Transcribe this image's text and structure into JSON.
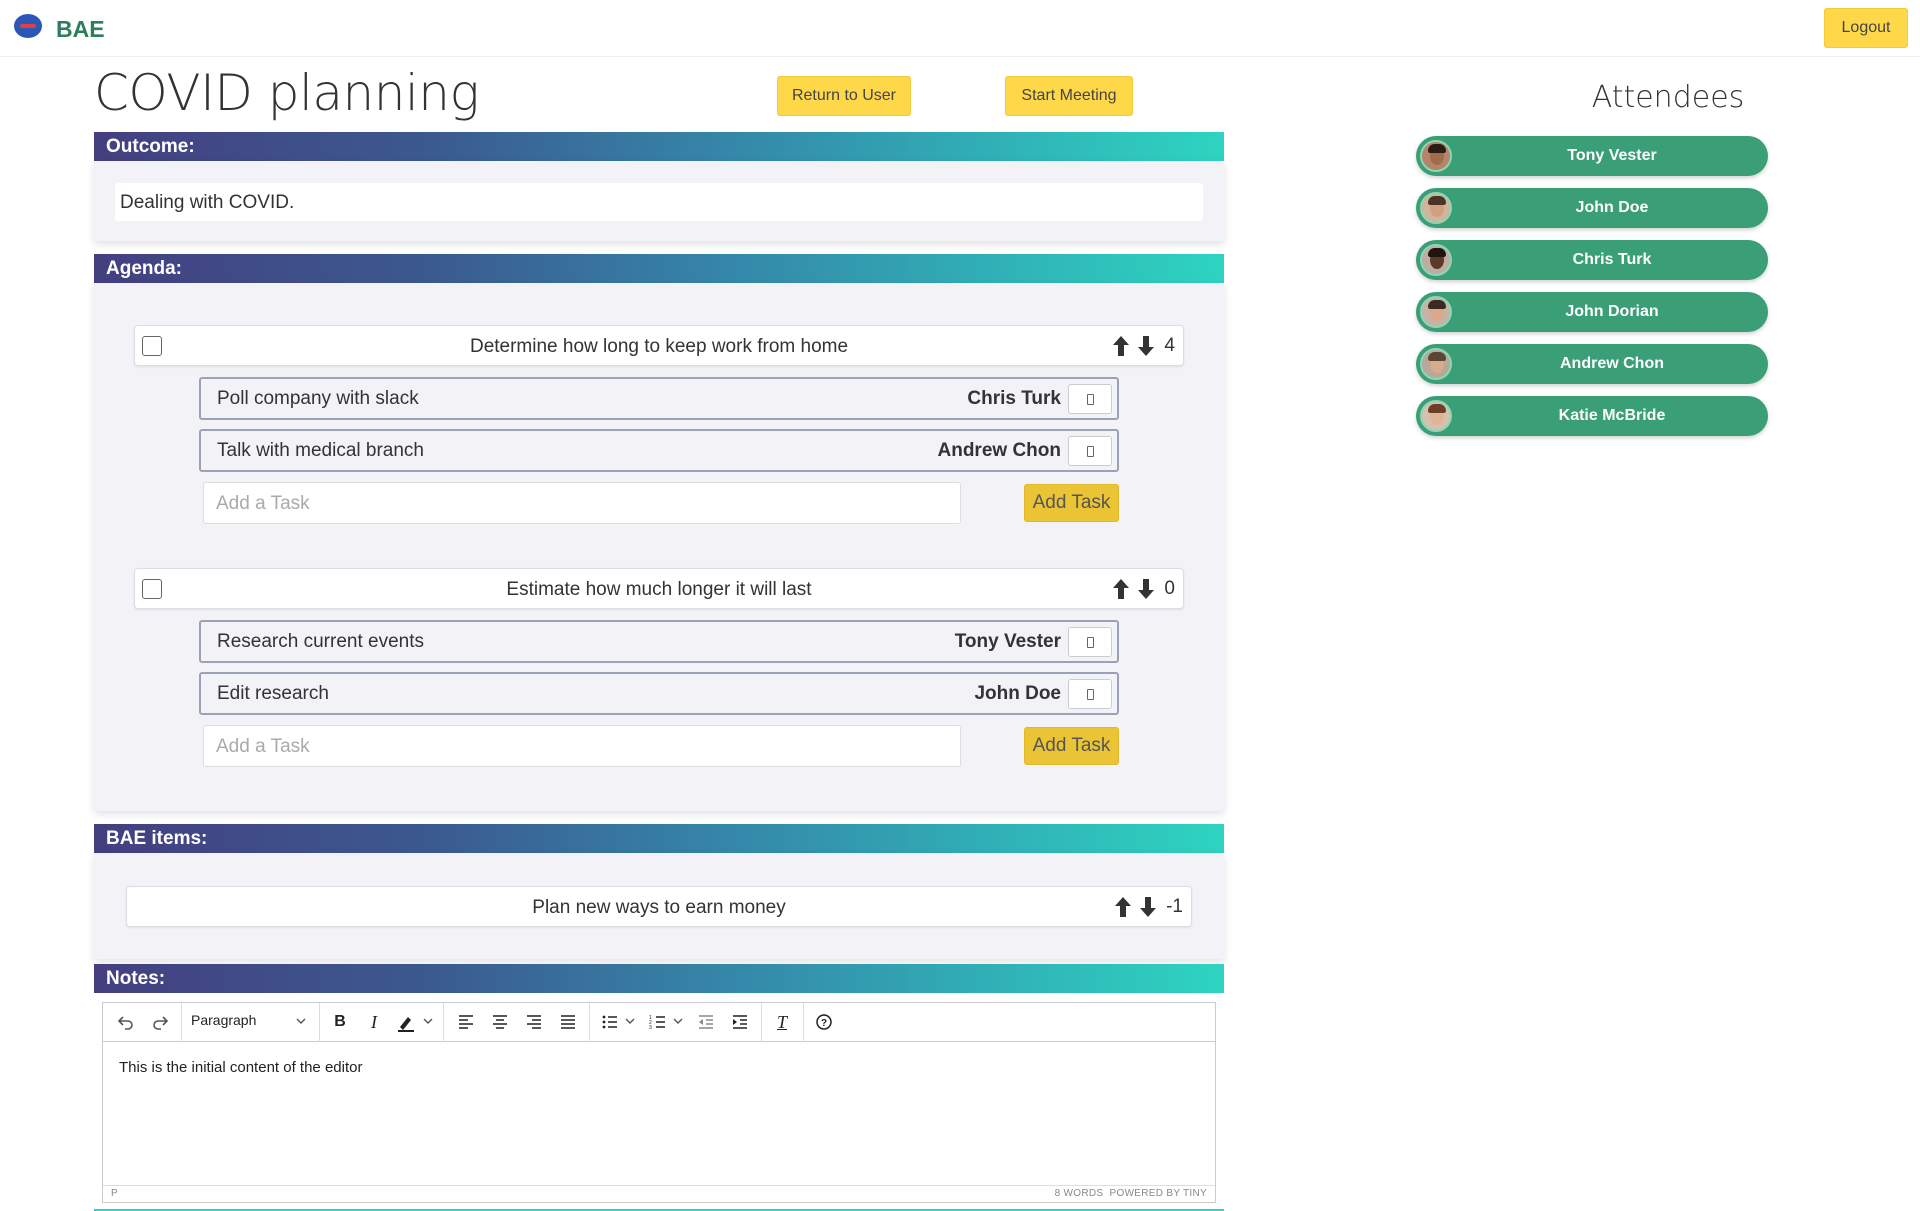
{
  "app": {
    "brand": "BAE",
    "logout_label": "Logout"
  },
  "meeting": {
    "title": "COVID planning",
    "return_label": "Return to User",
    "start_label": "Start Meeting"
  },
  "sections": {
    "outcome_label": "Outcome:",
    "agenda_label": "Agenda:",
    "bae_label": "BAE items:",
    "notes_label": "Notes:"
  },
  "outcome": "Dealing with COVID.",
  "agenda": [
    {
      "title": "Determine how long to keep work from home",
      "votes": "4",
      "tasks": [
        {
          "text": "Poll company with slack",
          "assignee": "Chris Turk"
        },
        {
          "text": "Talk with medical branch",
          "assignee": "Andrew Chon"
        }
      ],
      "add_placeholder": "Add a Task",
      "add_button": "Add Task"
    },
    {
      "title": "Estimate how much longer it will last",
      "votes": "0",
      "tasks": [
        {
          "text": "Research current events",
          "assignee": "Tony Vester"
        },
        {
          "text": "Edit research",
          "assignee": "John Doe"
        }
      ],
      "add_placeholder": "Add a Task",
      "add_button": "Add Task"
    }
  ],
  "bae_items": [
    {
      "title": "Plan new ways to earn money",
      "votes": "-1"
    }
  ],
  "notes": {
    "block_format": "Paragraph",
    "content": "This is the initial content of the editor",
    "path": "P",
    "word_count": "8 WORDS",
    "powered_by": "POWERED BY TINY",
    "toolbar_icons": [
      "undo-icon",
      "redo-icon",
      "bold-icon",
      "italic-icon",
      "highlight-icon",
      "align-left-icon",
      "align-center-icon",
      "align-right-icon",
      "align-justify-icon",
      "bullet-list-icon",
      "numbered-list-icon",
      "outdent-icon",
      "indent-icon",
      "clear-format-icon",
      "help-icon"
    ]
  },
  "attendees_title": "Attendees",
  "attendees": [
    {
      "name": "Tony Vester"
    },
    {
      "name": "John Doe"
    },
    {
      "name": "Chris Turk"
    },
    {
      "name": "John Dorian"
    },
    {
      "name": "Andrew Chon"
    },
    {
      "name": "Katie McBride"
    }
  ],
  "colors": {
    "brand": "#2e7d5b",
    "button_yellow": "#ffd84a",
    "add_task_yellow": "#ebc435",
    "attendee_green": "#3a9e76",
    "section_gradient_start": "#443f80",
    "section_gradient_end": "#2ed4c0"
  }
}
